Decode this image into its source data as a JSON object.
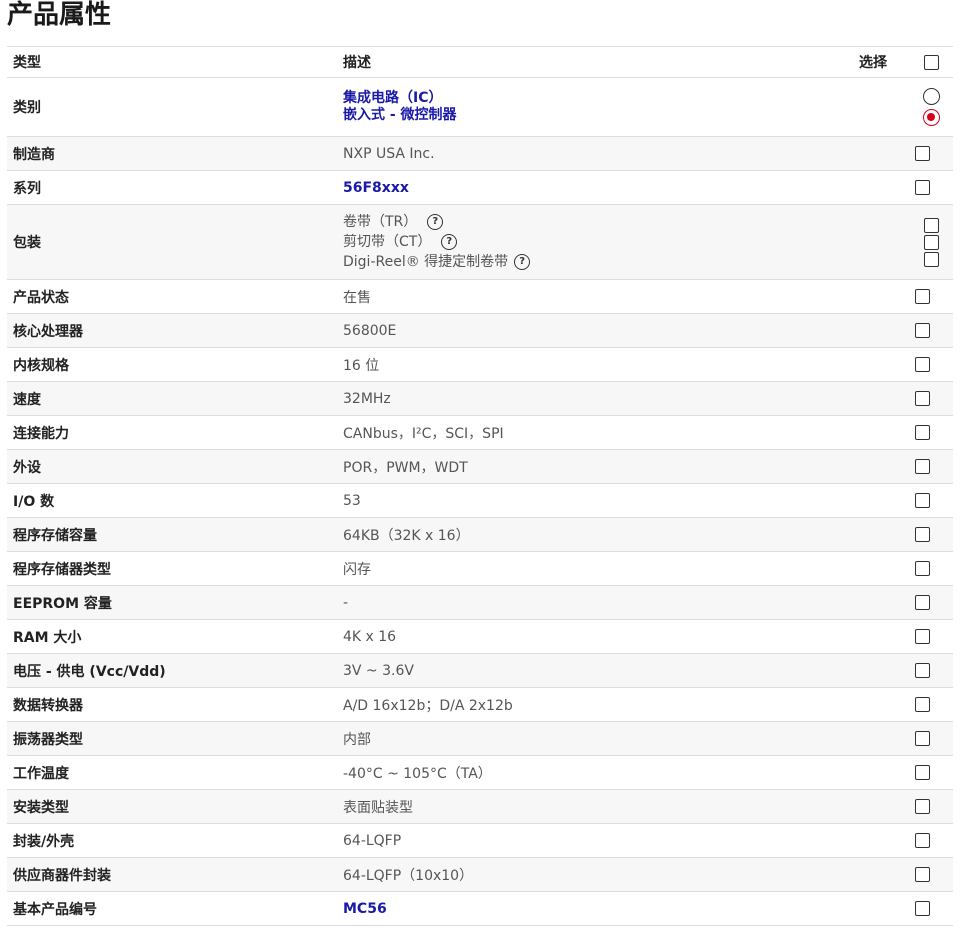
{
  "page_title": "产品属性",
  "header": {
    "type": "类型",
    "desc": "描述",
    "select": "选择"
  },
  "rows": {
    "category": {
      "name": "类别",
      "values": [
        "集成电路（IC）",
        "嵌入式 - 微控制器"
      ]
    },
    "manufacturer": {
      "name": "制造商",
      "value": "NXP USA Inc."
    },
    "series": {
      "name": "系列",
      "value": "56F8xxx"
    },
    "packaging": {
      "name": "包装",
      "values": [
        "卷带（TR）",
        "剪切带（CT）",
        "Digi-Reel® 得捷定制卷带"
      ],
      "help_icon": "?"
    },
    "status": {
      "name": "产品状态",
      "value": "在售"
    },
    "core_processor": {
      "name": "核心处理器",
      "value": "56800E"
    },
    "core_size": {
      "name": "内核规格",
      "value": "16 位"
    },
    "speed": {
      "name": "速度",
      "value": "32MHz"
    },
    "connectivity": {
      "name": "连接能力",
      "value": "CANbus，I²C，SCI，SPI"
    },
    "peripherals": {
      "name": "外设",
      "value": "POR，PWM，WDT"
    },
    "io_count": {
      "name": "I/O 数",
      "value": "53"
    },
    "program_memory_size": {
      "name": "程序存储容量",
      "value": "64KB（32K x 16）"
    },
    "program_memory_type": {
      "name": "程序存储器类型",
      "value": "闪存"
    },
    "eeprom_size": {
      "name": "EEPROM 容量",
      "value": "-"
    },
    "ram_size": {
      "name": "RAM 大小",
      "value": "4K x 16"
    },
    "voltage": {
      "name": "电压 - 供电 (Vcc/Vdd)",
      "value": "3V ~ 3.6V"
    },
    "data_converters": {
      "name": "数据转换器",
      "value": "A/D 16x12b；D/A 2x12b"
    },
    "oscillator_type": {
      "name": "振荡器类型",
      "value": "内部"
    },
    "operating_temp": {
      "name": "工作温度",
      "value": "-40°C ~ 105°C（TA）"
    },
    "mounting_type": {
      "name": "安装类型",
      "value": "表面贴装型"
    },
    "package_case": {
      "name": "封装/外壳",
      "value": "64-LQFP"
    },
    "supplier_package": {
      "name": "供应商器件封装",
      "value": "64-LQFP（10x10）"
    },
    "base_part_number": {
      "name": "基本产品编号",
      "value": "MC56"
    }
  },
  "colors": {
    "link": "#1a1aa6",
    "radio_selected": "#d6001c"
  },
  "icons": {
    "help": "question-circle-icon"
  }
}
